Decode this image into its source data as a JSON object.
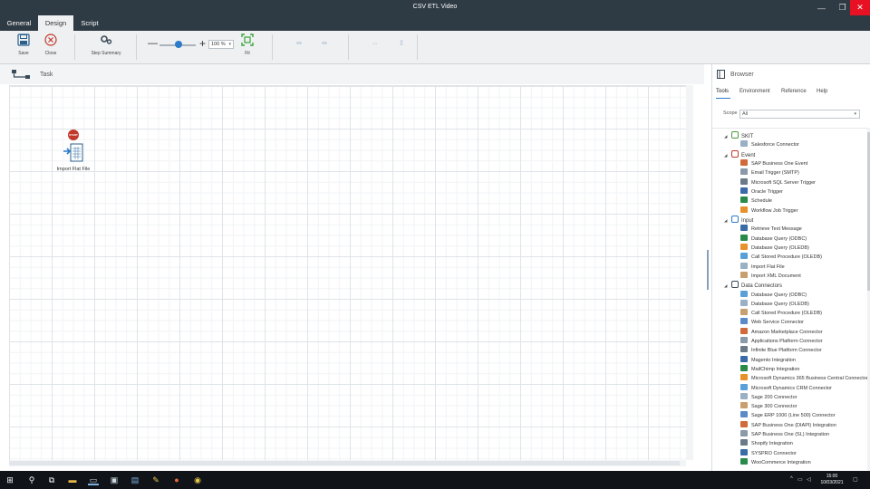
{
  "window": {
    "title": "CSV ETL Video",
    "minimize": "—",
    "maximize": "❐",
    "close": "✕"
  },
  "tabs": [
    {
      "label": "General"
    },
    {
      "label": "Design",
      "active": true
    },
    {
      "label": "Script"
    }
  ],
  "ribbon": {
    "save_label": "Save",
    "close_label": "Close",
    "step_summary_label": "Step Summary",
    "zoom_minus": "—",
    "zoom_plus": "+",
    "zoom_value": "100 %",
    "zoom_level_percent": 100,
    "fit_label": "Fit"
  },
  "task": {
    "title": "Task"
  },
  "canvas": {
    "start_badge": "START",
    "node_label": "Import Flat File"
  },
  "browser": {
    "title": "Browser",
    "tabs": [
      "Tools",
      "Environment",
      "Reference",
      "Help"
    ],
    "active_tab": "Tools",
    "scope_label": "Scope",
    "scope_value": "All",
    "tree": [
      {
        "category": "SKIT",
        "items": [
          "Salesforce Connector"
        ]
      },
      {
        "category": "Event",
        "items": [
          "SAP Business One Event",
          "Email Trigger (SMTP)",
          "Microsoft SQL Server Trigger",
          "Oracle Trigger",
          "Schedule",
          "Workflow Job Trigger"
        ]
      },
      {
        "category": "Input",
        "items": [
          "Retrieve Text Message",
          "Database Query (ODBC)",
          "Database Query (OLEDB)",
          "Call Stored Procedure (OLEDB)",
          "Import Flat File",
          "Import XML Document"
        ]
      },
      {
        "category": "Data Connectors",
        "items": [
          "Database Query (ODBC)",
          "Database Query (OLEDB)",
          "Call Stored Procedure (OLEDB)",
          "Web Service Connector",
          "Amazon Marketplace Connector",
          "Applications Platform Connector",
          "Infinite Blue Platform Connector",
          "Magento Integration",
          "MailChimp Integration",
          "Microsoft Dynamics 365 Business Central Connector",
          "Microsoft Dynamics CRM Connector",
          "Sage 200 Connector",
          "Sage 300 Connector",
          "Sage ERP 1000 (Line 500) Connector",
          "SAP Business One (DIAPI) Integration",
          "SAP Business One (SL) Integration",
          "Shopify Integration",
          "SYSPRO Connector",
          "WooCommerce Integration"
        ]
      }
    ]
  },
  "taskbar": {
    "time": "15:00",
    "date": "10/03/2021"
  },
  "colors": {
    "titlebar": "#2e3a44",
    "accent": "#2b7bc8",
    "close": "#e81123",
    "start": "#c0392b"
  }
}
